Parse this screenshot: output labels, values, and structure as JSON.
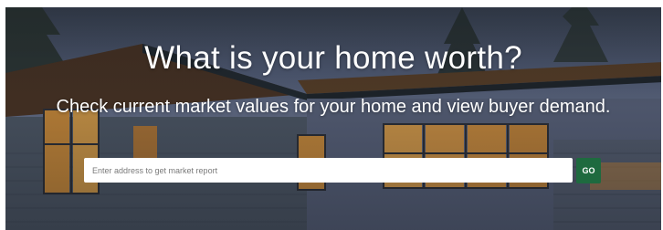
{
  "hero": {
    "title": "What is your home worth?",
    "subtitle": "Check current market values for your home and view buyer demand."
  },
  "search": {
    "placeholder": "Enter address to get market report",
    "value": "",
    "button_label": "GO"
  },
  "colors": {
    "button": "#1e6a3f",
    "text": "#ffffff",
    "input_background": "#ffffff"
  }
}
